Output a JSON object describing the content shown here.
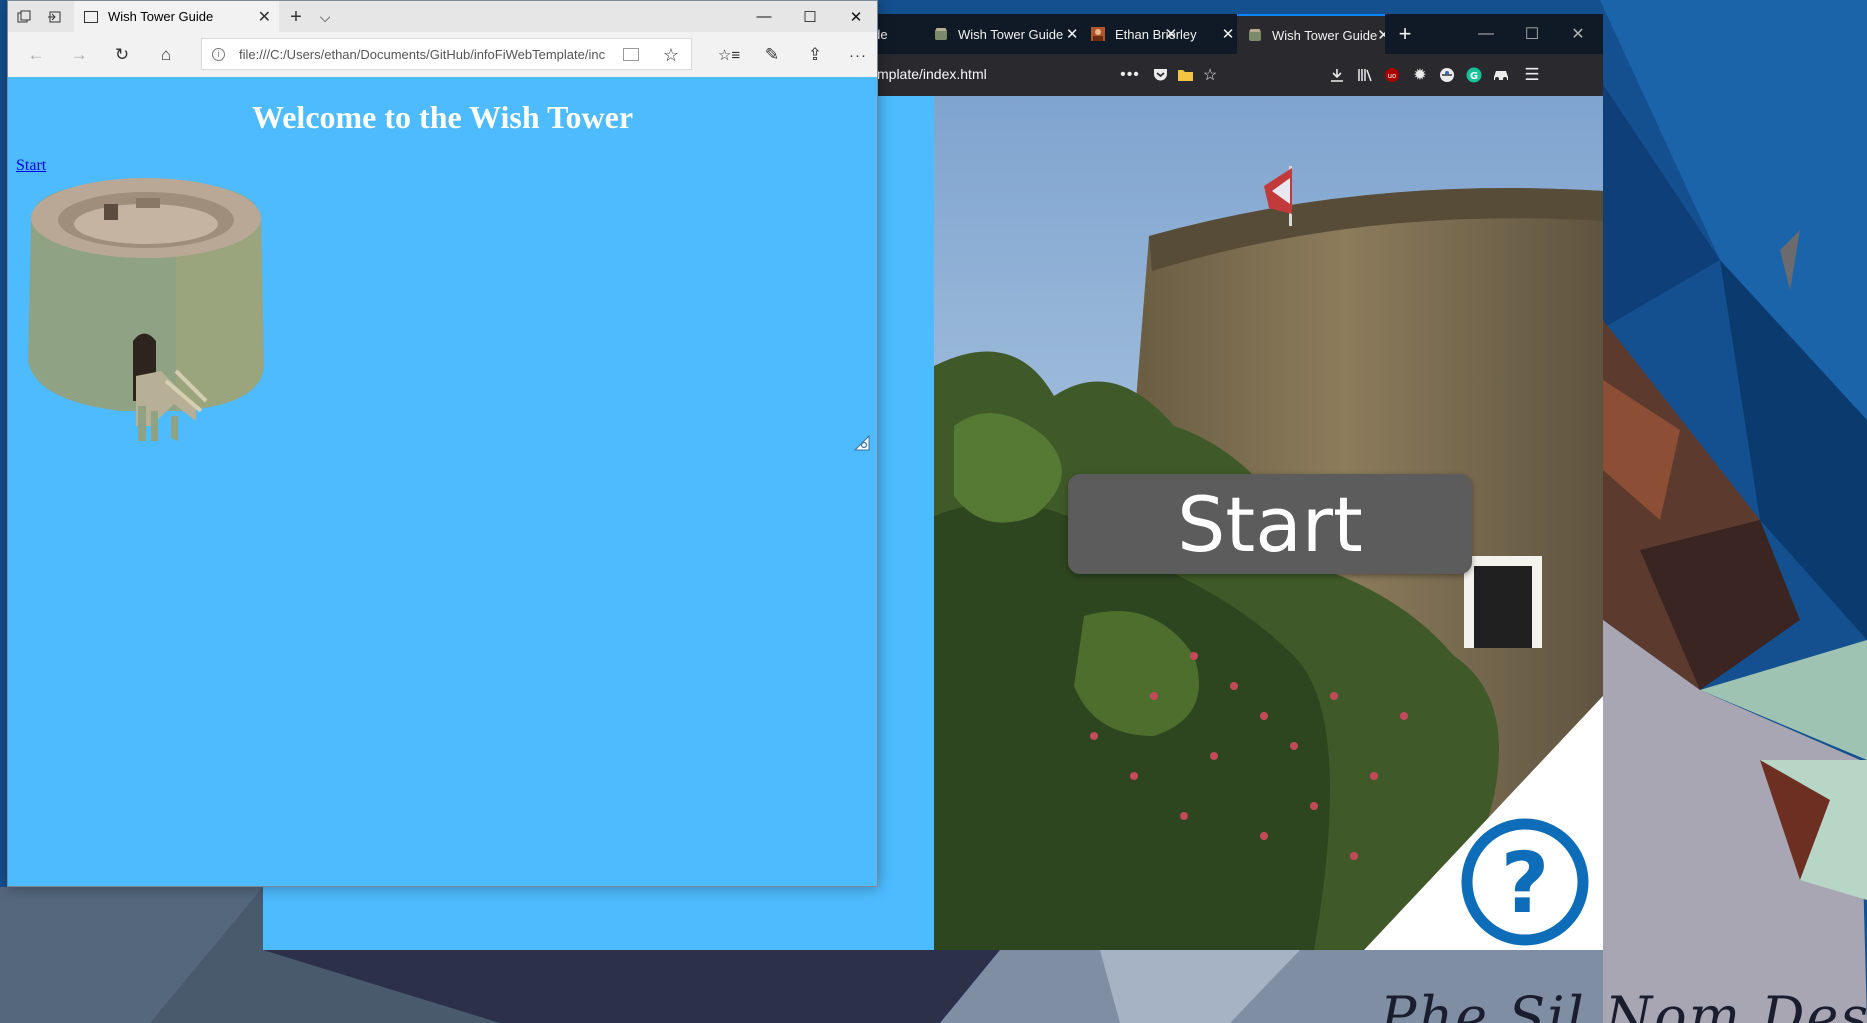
{
  "firefox": {
    "tabs": [
      {
        "label": "uide",
        "icon": "tower-favicon-icon"
      },
      {
        "label": "Wish Tower Guide",
        "icon": "tower-favicon-icon"
      },
      {
        "label": "Ethan Brierley",
        "icon": "avatar-favicon-icon"
      },
      {
        "label": "Wish Tower Guide",
        "icon": "tower-favicon-icon",
        "active": true
      }
    ],
    "new_tab": "+",
    "url_fragment": "mplate/index.html",
    "page": {
      "start_button": "Start",
      "help_button": "?"
    }
  },
  "edge": {
    "tab_title": "Wish Tower Guide",
    "url": "file:///C:/Users/ethan/Documents/GitHub/infoFiWebTemplate/inc",
    "page": {
      "heading": "Welcome to the Wish Tower",
      "start_link": "Start"
    }
  },
  "desktop": {
    "signature": "Phe Sil Nom Desig"
  },
  "colors": {
    "page_background": "#4dbbfd",
    "link": "#0000ee",
    "start_button_bg": "#5c5c5c",
    "help_ring": "#0e6db8",
    "firefox_chrome": "#2a2a2e",
    "edge_chrome": "#f2f2f2"
  }
}
